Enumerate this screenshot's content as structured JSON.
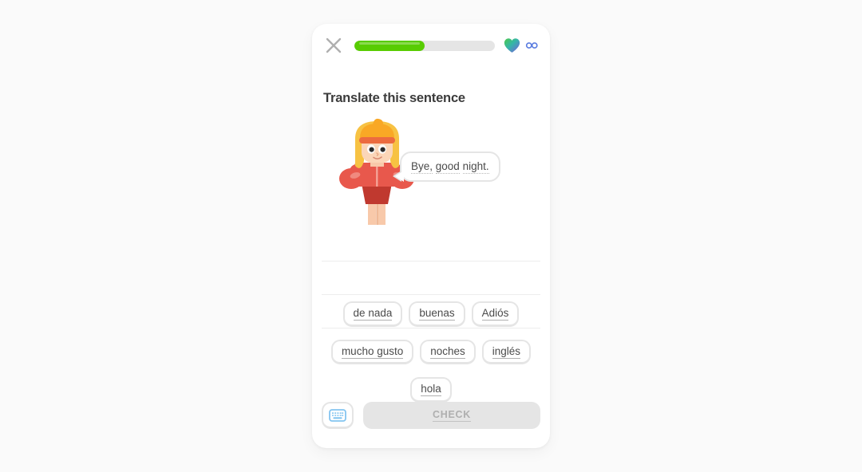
{
  "header": {
    "close_icon": "close-x-icon",
    "progress_percent": 50,
    "progress_fill_color": "#58cc02",
    "progress_track_color": "#e5e5e5",
    "hearts_icon": "heart-icon",
    "hearts_value": "∞",
    "infinity_icon": "infinity-icon"
  },
  "exercise": {
    "title": "Translate this sentence",
    "character_name": "duolingo-character-lily",
    "prompt_sentence": "Bye, good night.",
    "prompt_words": [
      "Bye,",
      "good",
      "night."
    ],
    "answer_line_count": 3,
    "answer_tokens": []
  },
  "word_bank": {
    "rows": [
      [
        "de nada",
        "buenas",
        "Adiós"
      ],
      [
        "mucho gusto",
        "noches",
        "inglés"
      ],
      [
        "hola"
      ]
    ],
    "tiles": [
      "de nada",
      "buenas",
      "Adiós",
      "mucho gusto",
      "noches",
      "inglés",
      "hola"
    ]
  },
  "footer": {
    "keyboard_icon": "keyboard-icon",
    "check_label": "CHECK",
    "check_enabled": false
  },
  "colors": {
    "page_background": "#fafafa",
    "card_background": "#ffffff",
    "accent_green": "#58cc02",
    "text_primary": "#3c3c3c",
    "text_secondary": "#4b4b4b",
    "border_gray": "#e5e5e5",
    "disabled_text": "#afafaf",
    "keyboard_blue": "#84c5f0",
    "character_jacket": "#e8584c",
    "character_hair": "#f7c243"
  }
}
